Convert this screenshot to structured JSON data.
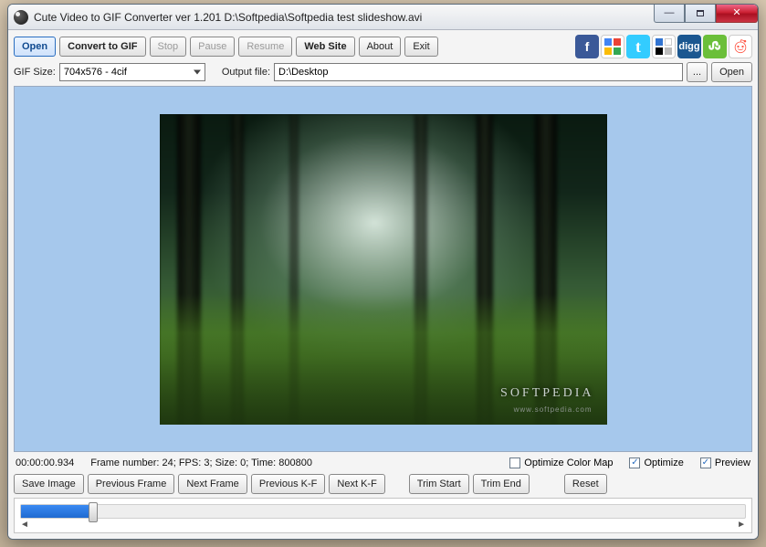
{
  "window": {
    "title": "Cute Video to GIF Converter ver 1.201  D:\\Softpedia\\Softpedia test slideshow.avi"
  },
  "toolbar": {
    "open": "Open",
    "convert": "Convert to GIF",
    "stop": "Stop",
    "pause": "Pause",
    "resume": "Resume",
    "website": "Web Site",
    "about": "About",
    "exit": "Exit"
  },
  "social": {
    "digg": "digg"
  },
  "row2": {
    "gif_size_label": "GIF Size:",
    "gif_size_value": "704x576 - 4cif",
    "output_label": "Output file:",
    "output_value": "D:\\Desktop",
    "browse": "...",
    "open": "Open"
  },
  "preview": {
    "watermark": "SOFTPEDIA",
    "watermark_sub": "www.softpedia.com"
  },
  "status": {
    "timecode": "00:00:00.934",
    "frameinfo": "Frame number: 24; FPS: 3; Size: 0; Time: 800800",
    "opt_colormap": "Optimize Color Map",
    "optimize": "Optimize",
    "preview": "Preview",
    "opt_colormap_checked": false,
    "optimize_checked": true,
    "preview_checked": true
  },
  "frame_buttons": {
    "save_image": "Save Image",
    "prev_frame": "Previous Frame",
    "next_frame": "Next Frame",
    "prev_kf": "Previous K-F",
    "next_kf": "Next K-F",
    "trim_start": "Trim Start",
    "trim_end": "Trim End",
    "reset": "Reset"
  },
  "slider": {
    "percent": 10,
    "mark_left": "◄",
    "mark_right": "►"
  }
}
